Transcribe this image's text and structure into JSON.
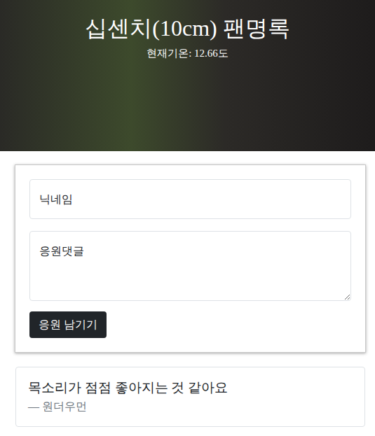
{
  "header": {
    "title": "십센치(10cm) 팬명록",
    "subtitle": "현재기온: 12.66도"
  },
  "form": {
    "nickname_placeholder": "닉네임",
    "comment_placeholder": "응원댓글",
    "button": "응원 남기기"
  },
  "comments": [
    {
      "text": "목소리가 점점 좋아지는 것 같아요",
      "author": "— 원더우먼"
    }
  ]
}
